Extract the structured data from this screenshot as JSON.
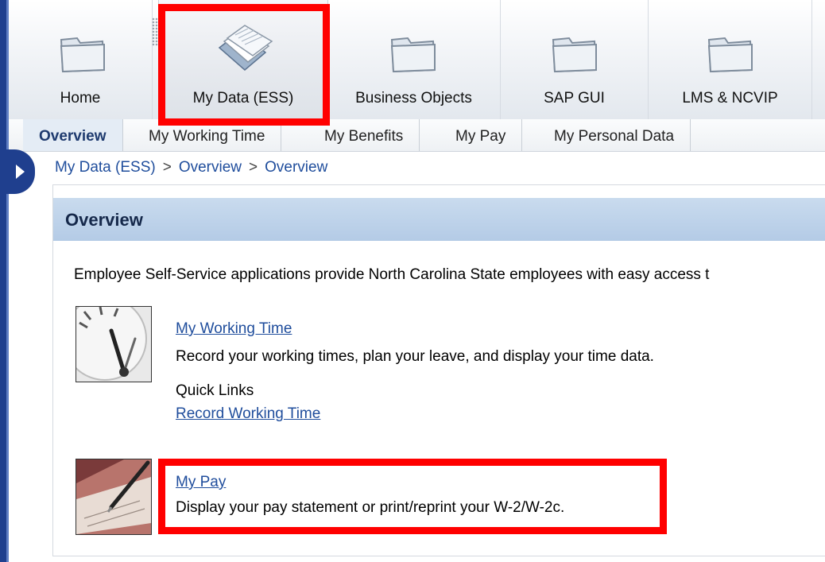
{
  "topnav": {
    "tabs": [
      {
        "label": "Home",
        "icon": "folder-icon"
      },
      {
        "label": "My Data (ESS)",
        "icon": "documents-icon"
      },
      {
        "label": "Business Objects",
        "icon": "folder-icon"
      },
      {
        "label": "SAP GUI",
        "icon": "folder-icon"
      },
      {
        "label": "LMS & NCVIP",
        "icon": "folder-icon"
      }
    ],
    "active": "My Data (ESS)"
  },
  "subnav": {
    "tabs": [
      {
        "label": "Overview"
      },
      {
        "label": "My Working Time"
      },
      {
        "label": "My Benefits"
      },
      {
        "label": "My Pay"
      },
      {
        "label": "My Personal Data"
      }
    ],
    "active": "Overview"
  },
  "breadcrumb": {
    "items": [
      "My Data (ESS)",
      "Overview",
      "Overview"
    ],
    "separator": ">"
  },
  "panel": {
    "title": "Overview",
    "intro": "Employee Self-Service applications provide North Carolina State employees with easy access t",
    "sections": [
      {
        "link": "My Working Time",
        "description": "Record your working times, plan your leave, and display your time data.",
        "quick_links_label": "Quick Links",
        "quick_links": [
          "Record Working Time"
        ]
      },
      {
        "link": "My Pay",
        "description": "Display your pay statement or print/reprint your W-2/W-2c."
      }
    ]
  },
  "colors": {
    "highlight": "#ff0000",
    "link": "#1f4d9c",
    "rail": "#1f3f8e",
    "panel_header": "#b4cbe6"
  }
}
